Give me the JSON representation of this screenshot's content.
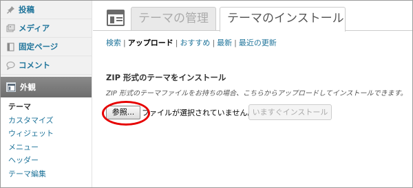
{
  "sidebar": {
    "items": [
      {
        "label": "投稿",
        "icon": "pin-icon"
      },
      {
        "label": "メディア",
        "icon": "media-icon"
      },
      {
        "label": "固定ページ",
        "icon": "page-icon"
      },
      {
        "label": "コメント",
        "icon": "comment-icon"
      }
    ],
    "active": {
      "label": "外観",
      "icon": "appearance-icon"
    },
    "submenu": [
      "テーマ",
      "カスタマイズ",
      "ウィジェット",
      "メニュー",
      "ヘッダー",
      "テーマ編集"
    ]
  },
  "tabs": [
    {
      "label": "テーマの管理"
    },
    {
      "label": "テーマのインストール"
    }
  ],
  "subnav": [
    "検索",
    "アップロード",
    "おすすめ",
    "最新",
    "最近の更新"
  ],
  "upload": {
    "heading": "ZIP 形式のテーマをインストール",
    "description": "ZIP 形式のテーマファイルをお持ちの場合、こちらからアップロードしてインストールできます。",
    "browse_label": "参照...",
    "file_status": "ファイルが選択されていません。",
    "install_label": "いますぐインストール"
  },
  "colors": {
    "link": "#21759b",
    "highlight": "#e60000",
    "active_menu": "#777777"
  }
}
